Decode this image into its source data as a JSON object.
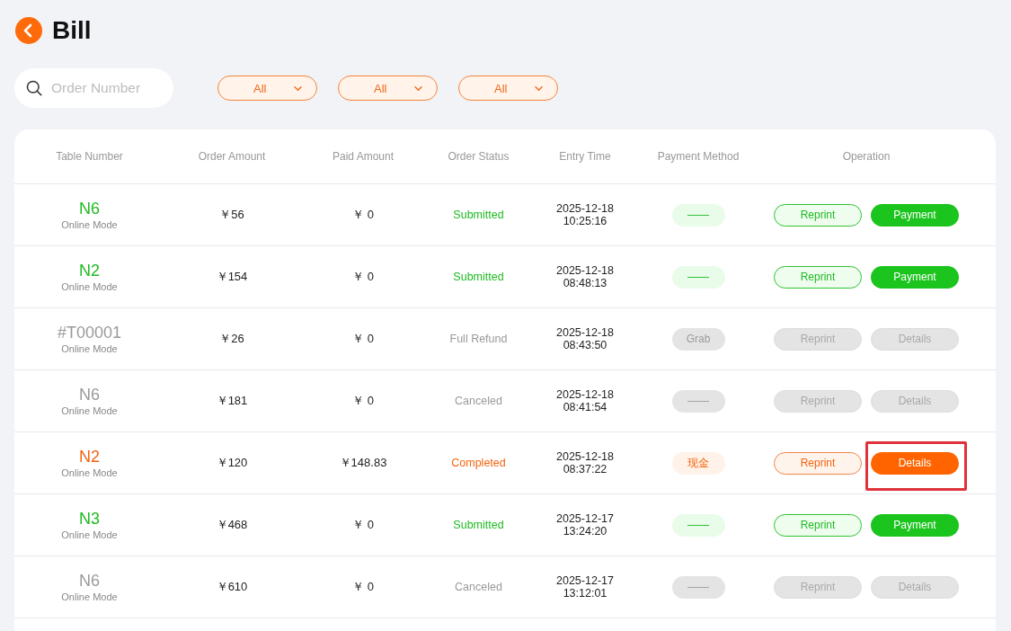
{
  "header": {
    "title": "Bill"
  },
  "search": {
    "placeholder": "Order Number"
  },
  "filters": [
    {
      "value": "All"
    },
    {
      "value": "All"
    },
    {
      "value": "All"
    }
  ],
  "table": {
    "columns": [
      "Table Number",
      "Order Amount",
      "Paid Amount",
      "Order Status",
      "Entry Time",
      "Payment Method",
      "Operation"
    ],
    "rows": [
      {
        "kind": "submitted",
        "table_number": "N6",
        "mode": "Online Mode",
        "order_amount": "￥56",
        "paid_amount": "￥ 0",
        "status": "Submitted",
        "entry_date": "2025-12-18",
        "entry_time": "10:25:16",
        "payment_method": "——",
        "buttons": [
          {
            "label": "Reprint",
            "kind": "outline",
            "highlighted": false
          },
          {
            "label": "Payment",
            "kind": "filled",
            "highlighted": false
          }
        ]
      },
      {
        "kind": "submitted",
        "table_number": "N2",
        "mode": "Online Mode",
        "order_amount": "￥154",
        "paid_amount": "￥ 0",
        "status": "Submitted",
        "entry_date": "2025-12-18",
        "entry_time": "08:48:13",
        "payment_method": "——",
        "buttons": [
          {
            "label": "Reprint",
            "kind": "outline",
            "highlighted": false
          },
          {
            "label": "Payment",
            "kind": "filled",
            "highlighted": false
          }
        ]
      },
      {
        "kind": "refunded",
        "table_number": "#T00001",
        "mode": "Online Mode",
        "order_amount": "￥26",
        "paid_amount": "￥ 0",
        "status": "Full Refund",
        "entry_date": "2025-12-18",
        "entry_time": "08:43:50",
        "payment_method": "Grab",
        "buttons": [
          {
            "label": "Reprint",
            "kind": "outline",
            "highlighted": false
          },
          {
            "label": "Details",
            "kind": "filled",
            "highlighted": false
          }
        ]
      },
      {
        "kind": "canceled",
        "table_number": "N6",
        "mode": "Online Mode",
        "order_amount": "￥181",
        "paid_amount": "￥ 0",
        "status": "Canceled",
        "entry_date": "2025-12-18",
        "entry_time": "08:41:54",
        "payment_method": "——",
        "buttons": [
          {
            "label": "Reprint",
            "kind": "outline",
            "highlighted": false
          },
          {
            "label": "Details",
            "kind": "filled",
            "highlighted": false
          }
        ]
      },
      {
        "kind": "completed",
        "table_number": "N2",
        "mode": "Online Mode",
        "order_amount": "￥120",
        "paid_amount": "￥148.83",
        "status": "Completed",
        "entry_date": "2025-12-18",
        "entry_time": "08:37:22",
        "payment_method": "现金",
        "buttons": [
          {
            "label": "Reprint",
            "kind": "outline",
            "highlighted": false
          },
          {
            "label": "Details",
            "kind": "filled",
            "highlighted": true
          }
        ]
      },
      {
        "kind": "submitted",
        "table_number": "N3",
        "mode": "Online Mode",
        "order_amount": "￥468",
        "paid_amount": "￥ 0",
        "status": "Submitted",
        "entry_date": "2025-12-17",
        "entry_time": "13:24:20",
        "payment_method": "——",
        "buttons": [
          {
            "label": "Reprint",
            "kind": "outline",
            "highlighted": false
          },
          {
            "label": "Payment",
            "kind": "filled",
            "highlighted": false
          }
        ]
      },
      {
        "kind": "canceled",
        "table_number": "N6",
        "mode": "Online Mode",
        "order_amount": "￥610",
        "paid_amount": "￥ 0",
        "status": "Canceled",
        "entry_date": "2025-12-17",
        "entry_time": "13:12:01",
        "payment_method": "——",
        "buttons": [
          {
            "label": "Reprint",
            "kind": "outline",
            "highlighted": false
          },
          {
            "label": "Details",
            "kind": "filled",
            "highlighted": false
          }
        ]
      }
    ]
  }
}
